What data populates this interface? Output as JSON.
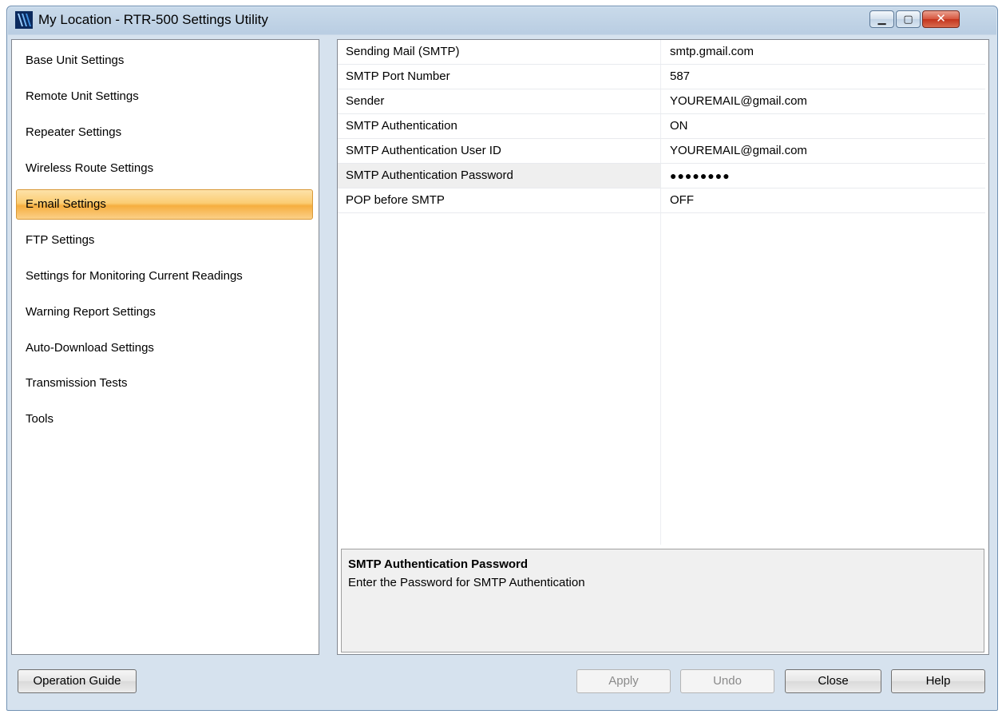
{
  "window": {
    "title": "My Location - RTR-500 Settings Utility",
    "controls": {
      "minimize": "▁",
      "maximize": "▢",
      "close": "✕"
    }
  },
  "sidebar": {
    "items": [
      {
        "label": "Base Unit Settings"
      },
      {
        "label": "Remote Unit Settings"
      },
      {
        "label": "Repeater Settings"
      },
      {
        "label": "Wireless Route Settings"
      },
      {
        "label": "E-mail Settings",
        "selected": true
      },
      {
        "label": "FTP Settings"
      },
      {
        "label": "Settings for Monitoring Current Readings"
      },
      {
        "label": "Warning Report Settings"
      },
      {
        "label": "Auto-Download Settings"
      },
      {
        "label": "Transmission Tests"
      },
      {
        "label": "Tools"
      }
    ]
  },
  "properties": {
    "rows": [
      {
        "name": "Sending Mail (SMTP)",
        "value": "smtp.gmail.com"
      },
      {
        "name": "SMTP Port Number",
        "value": "587"
      },
      {
        "name": "Sender",
        "value": "YOUREMAIL@gmail.com"
      },
      {
        "name": "SMTP Authentication",
        "value": "ON"
      },
      {
        "name": "SMTP Authentication User ID",
        "value": "YOUREMAIL@gmail.com"
      },
      {
        "name": "SMTP Authentication Password",
        "value": "●●●●●●●●",
        "selected": true
      },
      {
        "name": "POP before SMTP",
        "value": "OFF"
      }
    ]
  },
  "help": {
    "title": "SMTP Authentication Password",
    "description": "Enter the Password for SMTP Authentication"
  },
  "buttons": {
    "operation_guide": "Operation Guide",
    "apply": "Apply",
    "undo": "Undo",
    "close": "Close",
    "help": "Help"
  },
  "colors": {
    "selection_orange": "#f6ae3f",
    "title_gradient": "#b9cde2",
    "close_red": "#c3341c"
  }
}
